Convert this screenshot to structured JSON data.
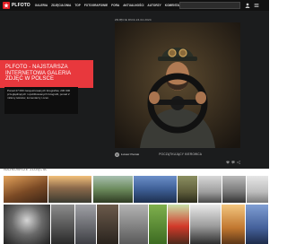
{
  "brand": {
    "name": "PLFOTO"
  },
  "nav": [
    {
      "label": "GALERIA"
    },
    {
      "label": "ZDJĘCIA DNIA"
    },
    {
      "label": "TOP"
    },
    {
      "label": "FOTOGRAFOWIE"
    },
    {
      "label": "FORA"
    },
    {
      "label": "AKTUALNOŚCI"
    },
    {
      "label": "AUTORZY"
    },
    {
      "label": "KOMENTARZE"
    }
  ],
  "search": {
    "placeholder": ""
  },
  "hero": {
    "caption": "ZDJĘCIE DNIA 24.04.2024",
    "author": "Łukasz Pieniak",
    "photo_title": "POCZĄTKUJĄCY KIEROWCA",
    "promo_title": "PLFOTO - NAJSTARSZA INTERNETOWA GALERIA ZDJĘĆ W POLSCE",
    "promo_desc": "Ponad 27 000 zarejestrowanych fotografów, 236 000 przeglądniętych i opublikowanych fotografii, ponad 2 miliony tekstów, komentarzy i ocen."
  },
  "latest": {
    "heading": "NAJNOWSZE ZDJĘCIA"
  },
  "colors": {
    "accent": "#e8383d",
    "topbar": "#111111",
    "hero_bg": "#1b1c1d"
  },
  "icons": [
    "logo-icon",
    "search-icon",
    "user-icon",
    "menu-icon",
    "heart-icon",
    "comment-icon",
    "share-icon"
  ]
}
